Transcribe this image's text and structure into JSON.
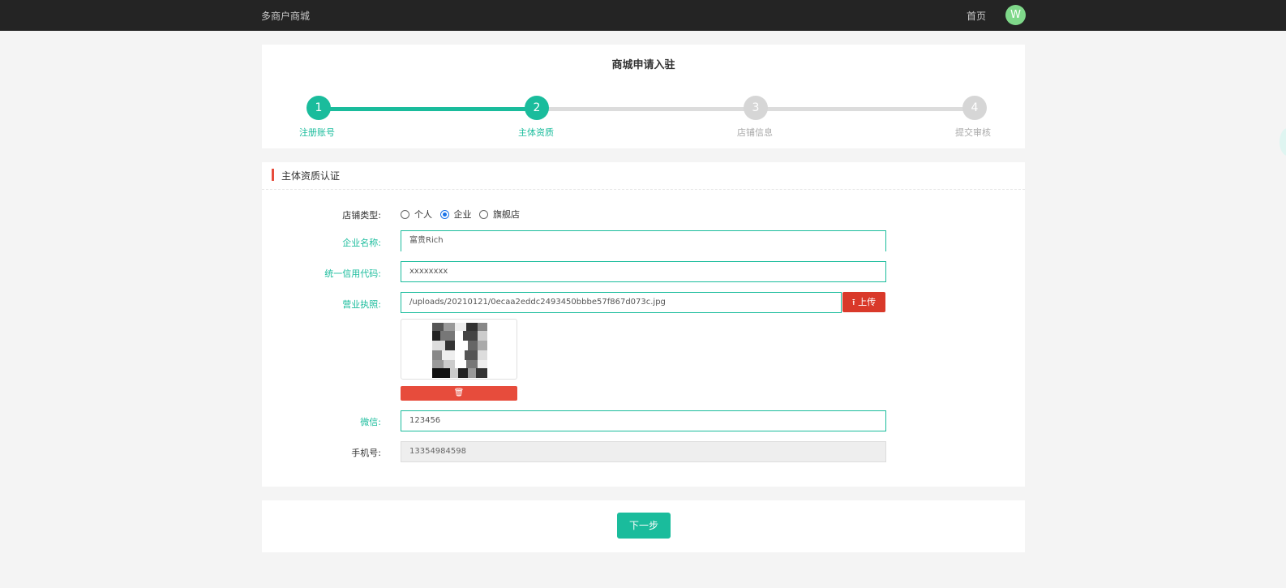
{
  "header": {
    "brand": "多商户商城",
    "home_link": "首页",
    "avatar_letter": "W",
    "avatar_color": "#7fd88a"
  },
  "steps": {
    "title": "商城申请入驻",
    "items": [
      {
        "number": "1",
        "label": "注册账号",
        "state": "done"
      },
      {
        "number": "2",
        "label": "主体资质",
        "state": "current"
      },
      {
        "number": "3",
        "label": "店铺信息",
        "state": "pending"
      },
      {
        "number": "4",
        "label": "提交审核",
        "state": "pending"
      }
    ],
    "active_color": "#1abc9c",
    "inactive_color": "#dcdcdc"
  },
  "form": {
    "section_title": "主体资质认证",
    "shop_type": {
      "label": "店铺类型:",
      "options": [
        "个人",
        "企业",
        "旗舰店"
      ],
      "selected": "企业"
    },
    "company_name": {
      "label": "企业名称:",
      "value": "富贵Rich"
    },
    "credit_code": {
      "label": "统一信用代码:",
      "value": "xxxxxxxx"
    },
    "business_license": {
      "label": "营业执照:",
      "value": "/uploads/20210121/0ecaa2eddc2493450bbbe57f867d073c.jpg",
      "upload_label": "上传"
    },
    "wechat": {
      "label": "微信:",
      "value": "123456"
    },
    "mobile": {
      "label": "手机号:",
      "value": "13354984598"
    }
  },
  "actions": {
    "next_label": "下一步"
  }
}
